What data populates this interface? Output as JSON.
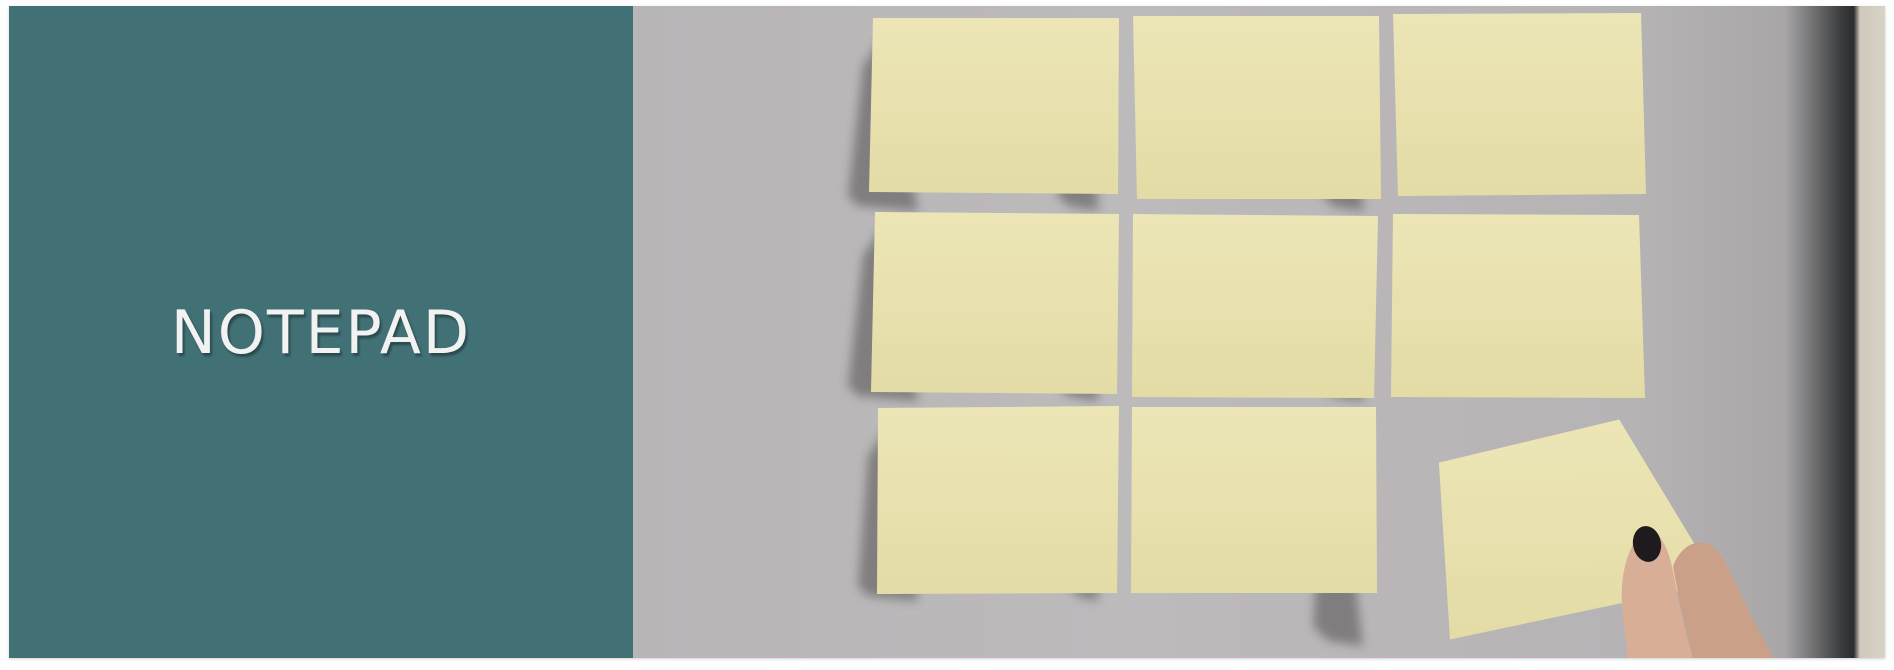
{
  "banner": {
    "title": "NOTEPAD",
    "panel_color": "#417175",
    "note_color": "#e9e2b0",
    "wall_color": "#bab7b9"
  },
  "photo": {
    "subject": "sticky-notes-on-wall",
    "note_count": 9
  }
}
